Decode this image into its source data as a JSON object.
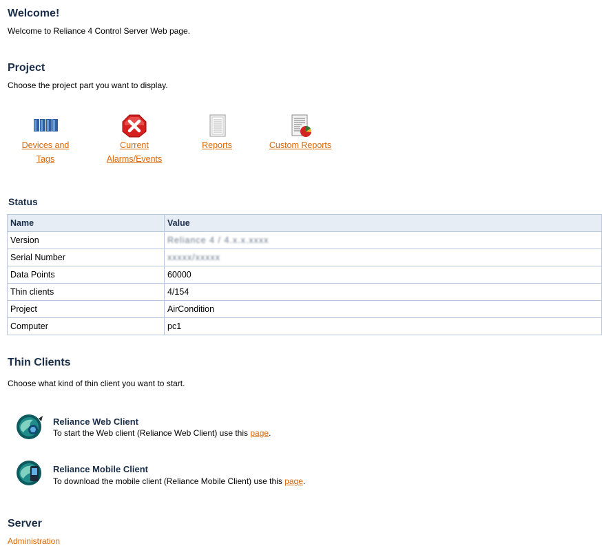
{
  "welcome": {
    "title": "Welcome!",
    "text": "Welcome to Reliance 4 Control Server Web page."
  },
  "project": {
    "title": "Project",
    "text": "Choose the project part you want to display.",
    "items": [
      {
        "line1": "Devices and",
        "line2": "Tags",
        "icon": "devices-tags-icon"
      },
      {
        "line1": "Current",
        "line2": "Alarms/Events",
        "icon": "alarm-x-icon"
      },
      {
        "line1": "Reports",
        "line2": "",
        "icon": "report-document-icon"
      },
      {
        "line1": "Custom Reports",
        "line2": "",
        "icon": "custom-report-chart-icon"
      }
    ]
  },
  "status": {
    "title": "Status",
    "headers": [
      "Name",
      "Value"
    ],
    "rows": [
      {
        "name": "Version",
        "value": "Reliance 4 / 4.x.x.xxxx"
      },
      {
        "name": "Serial Number",
        "value": "xxxxx/xxxxx"
      },
      {
        "name": "Data Points",
        "value": "60000"
      },
      {
        "name": "Thin clients",
        "value": "4/154"
      },
      {
        "name": "Project",
        "value": "AirCondition"
      },
      {
        "name": "Computer",
        "value": "pc1"
      }
    ]
  },
  "thin_clients": {
    "title": "Thin Clients",
    "text": "Choose what kind of thin client you want to start.",
    "clients": [
      {
        "title": "Reliance Web Client",
        "desc": "To start the Web client (Reliance Web Client) use this ",
        "link": "page",
        "end": ".",
        "icon": "web-client-icon"
      },
      {
        "title": "Reliance Mobile Client",
        "desc": "To download the mobile client (Reliance Mobile Client) use this ",
        "link": "page",
        "end": ".",
        "icon": "mobile-client-icon"
      }
    ]
  },
  "server": {
    "title": "Server",
    "link": "Administration"
  },
  "colors": {
    "heading": "#1a2e4a",
    "link": "#d9680b",
    "table_border": "#b6c8dd",
    "table_header_bg": "#e7edf4"
  }
}
